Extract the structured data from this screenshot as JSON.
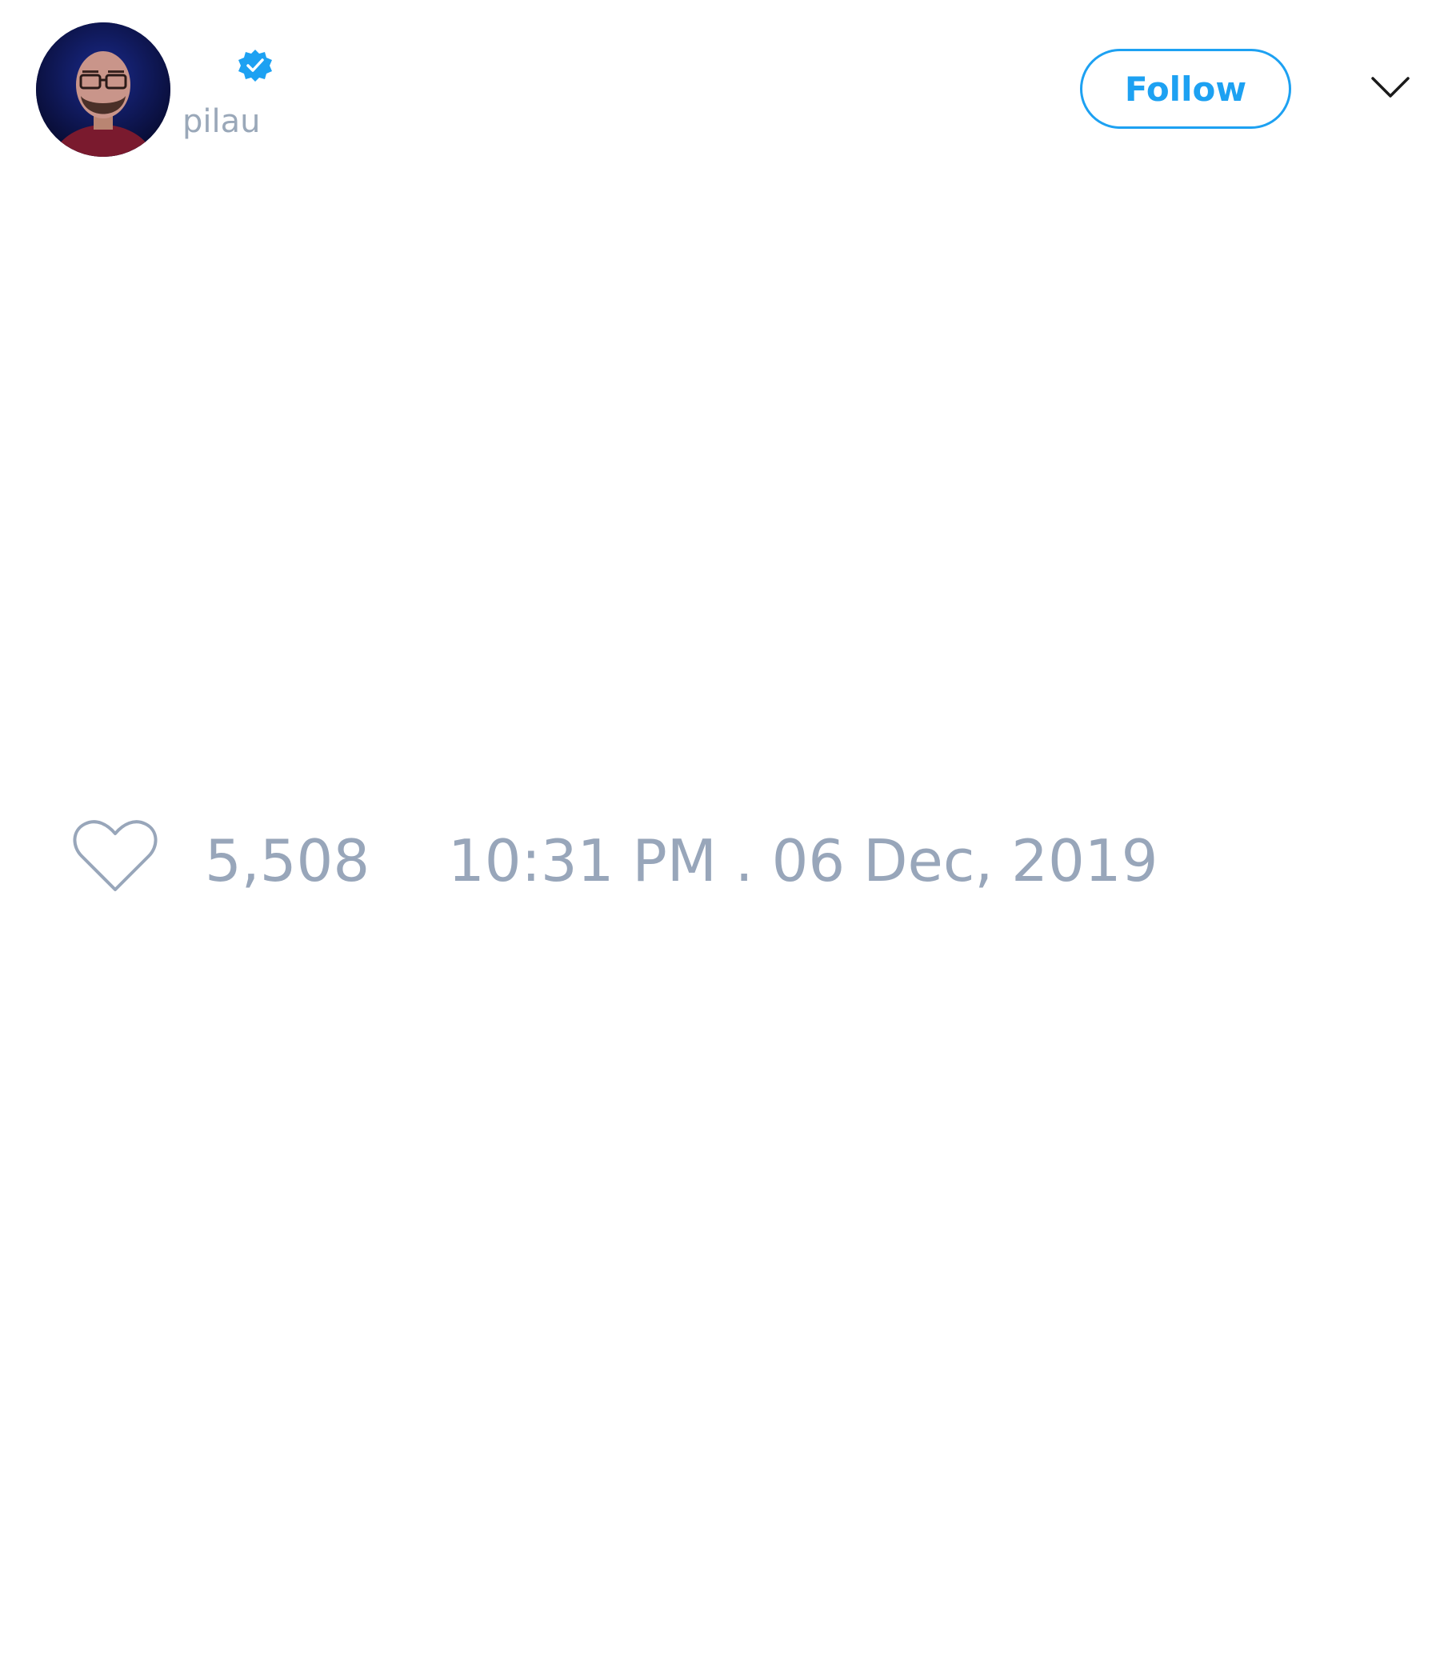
{
  "tweet": {
    "author": {
      "screen_name": "pilau",
      "verified": true,
      "avatar_icon": "person-avatar-photo"
    },
    "follow_button": {
      "label": "Follow"
    },
    "menu_icon": "chevron-down-icon",
    "like": {
      "icon": "heart-icon",
      "count": "5,508"
    },
    "timestamp": "10:31 PM . 06 Dec, 2019"
  },
  "colors": {
    "brand_blue": "#1da1f2",
    "muted_text": "#98a6ba",
    "background": "#ffffff"
  }
}
